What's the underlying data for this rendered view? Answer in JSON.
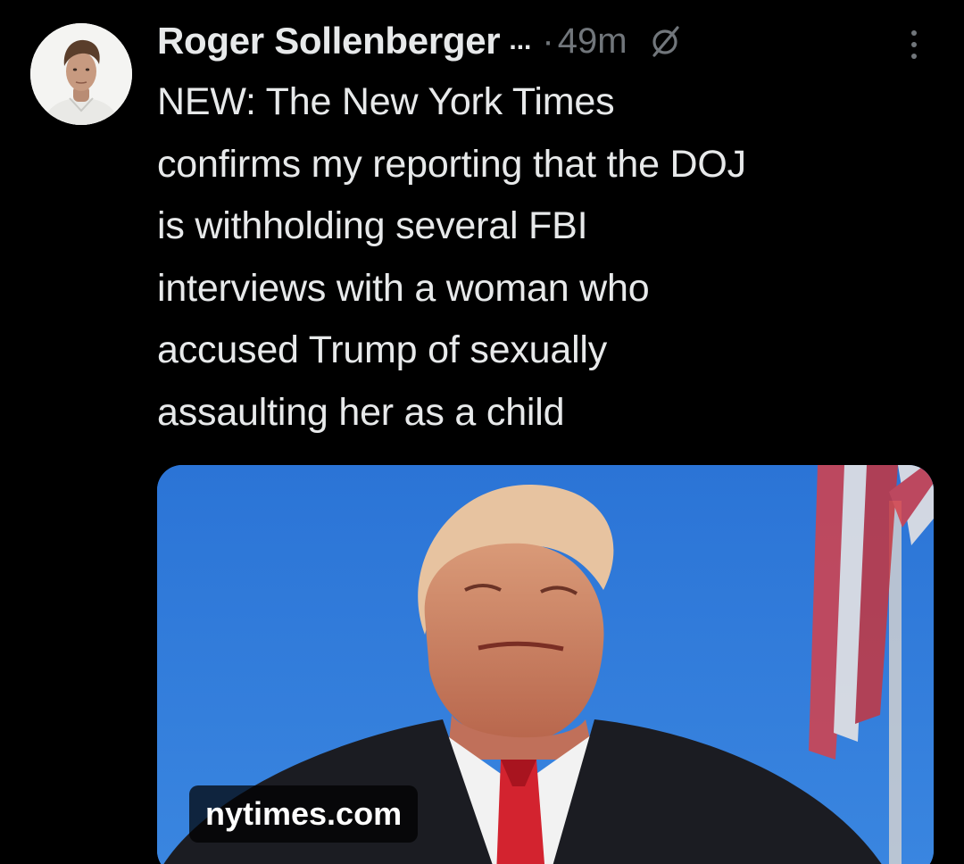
{
  "tweet": {
    "author": {
      "name": "Roger Sollenberger",
      "truncation": "...",
      "avatar_icon": "avatar-photo"
    },
    "separator": "·",
    "timestamp": "49m",
    "status_icon": "automated-slash-icon",
    "more_icon": "more-vertical-icon",
    "text": "NEW: The New York Times\nconfirms my reporting that the DOJ\nis withholding several FBI\ninterviews with a woman who\naccused Trump of sexually\nassaulting her as a child",
    "link_card": {
      "domain": "nytimes.com",
      "image_icon": "article-photo"
    }
  },
  "colors": {
    "background": "#000000",
    "text_primary": "#e7e9ea",
    "text_secondary": "#71767b",
    "sky": "#2a6fd0"
  }
}
